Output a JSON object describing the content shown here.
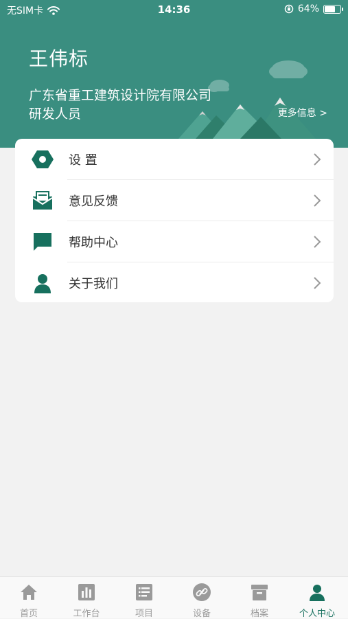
{
  "status_bar": {
    "carrier": "无SIM卡",
    "time": "14:36",
    "battery": "64%"
  },
  "profile": {
    "name": "王伟标",
    "company": "广东省重工建筑设计院有限公司",
    "role": "研发人员",
    "more_info": "更多信息 >"
  },
  "menu": {
    "items": [
      {
        "label": "设  置",
        "icon": "hex-nut-icon"
      },
      {
        "label": "意见反馈",
        "icon": "mail-icon"
      },
      {
        "label": "帮助中心",
        "icon": "chat-bubble-icon"
      },
      {
        "label": "关于我们",
        "icon": "person-icon"
      }
    ]
  },
  "tabbar": {
    "tabs": [
      {
        "label": "首页",
        "icon": "home-icon"
      },
      {
        "label": "工作台",
        "icon": "bar-chart-icon"
      },
      {
        "label": "项目",
        "icon": "list-doc-icon"
      },
      {
        "label": "设备",
        "icon": "link-icon"
      },
      {
        "label": "档案",
        "icon": "archive-box-icon"
      },
      {
        "label": "个人中心",
        "icon": "person-icon"
      }
    ],
    "active_index": 5
  },
  "colors": {
    "header_bg": "#3a8e80",
    "accent": "#17705e",
    "tab_inactive": "#9a9a9a"
  }
}
